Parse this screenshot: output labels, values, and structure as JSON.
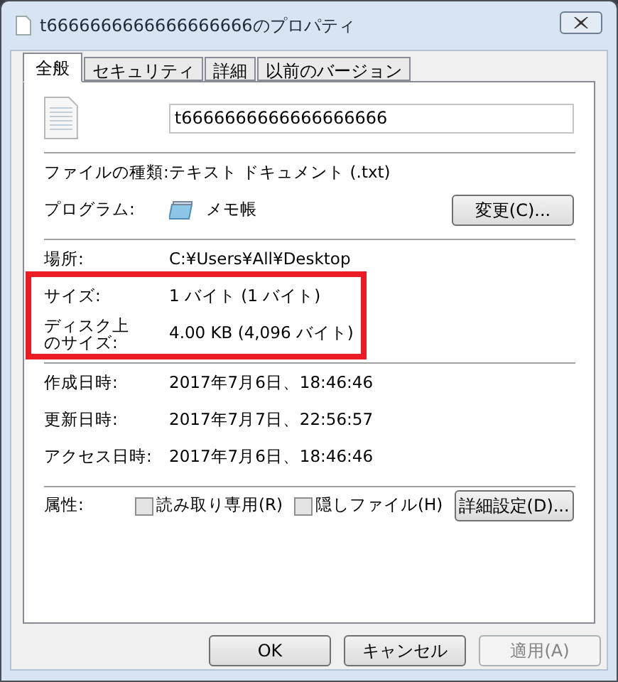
{
  "window": {
    "title": "t6666666666666666666のプロパティ"
  },
  "tabs": [
    {
      "label": "全般",
      "selected": true
    },
    {
      "label": "セキュリティ",
      "selected": false
    },
    {
      "label": "詳細",
      "selected": false
    },
    {
      "label": "以前のバージョン",
      "selected": false
    }
  ],
  "file_name": {
    "value": "t6666666666666666666"
  },
  "sections": [
    [
      {
        "label": "ファイルの種類:",
        "value": "テキスト ドキュメント (.txt)",
        "highlighted": false
      },
      {
        "label": "プログラム:",
        "value": "メモ帳",
        "app_icon": true,
        "button": "変更(C)...",
        "highlighted": false
      }
    ],
    [
      {
        "label": "場所:",
        "value": "C:¥Users¥All¥Desktop",
        "highlighted": false
      },
      {
        "label": "サイズ:",
        "value": "1 バイト (1 バイト)",
        "highlighted": true
      },
      {
        "label": "ディスク上のサイズ:",
        "wrapped": true,
        "value": "4.00 KB (4,096 バイト)",
        "highlighted": true
      }
    ],
    [
      {
        "label": "作成日時:",
        "value": "2017年7月6日、18:46:46",
        "highlighted": false
      },
      {
        "label": "更新日時:",
        "value": "2017年7月7日、22:56:57",
        "highlighted": false
      },
      {
        "label": "アクセス日時:",
        "value": "2017年7月6日、18:46:46",
        "highlighted": false
      }
    ]
  ],
  "attributes": {
    "label": "属性:",
    "options": [
      {
        "label": "読み取り専用(R)",
        "checked": false
      },
      {
        "label": "隠しファイル(H)",
        "checked": false
      }
    ],
    "button": "詳細設定(D)..."
  },
  "buttons": [
    {
      "label": "OK",
      "disabled": false
    },
    {
      "label": "キャンセル",
      "disabled": false
    },
    {
      "label": "適用(A)",
      "disabled": true
    }
  ]
}
